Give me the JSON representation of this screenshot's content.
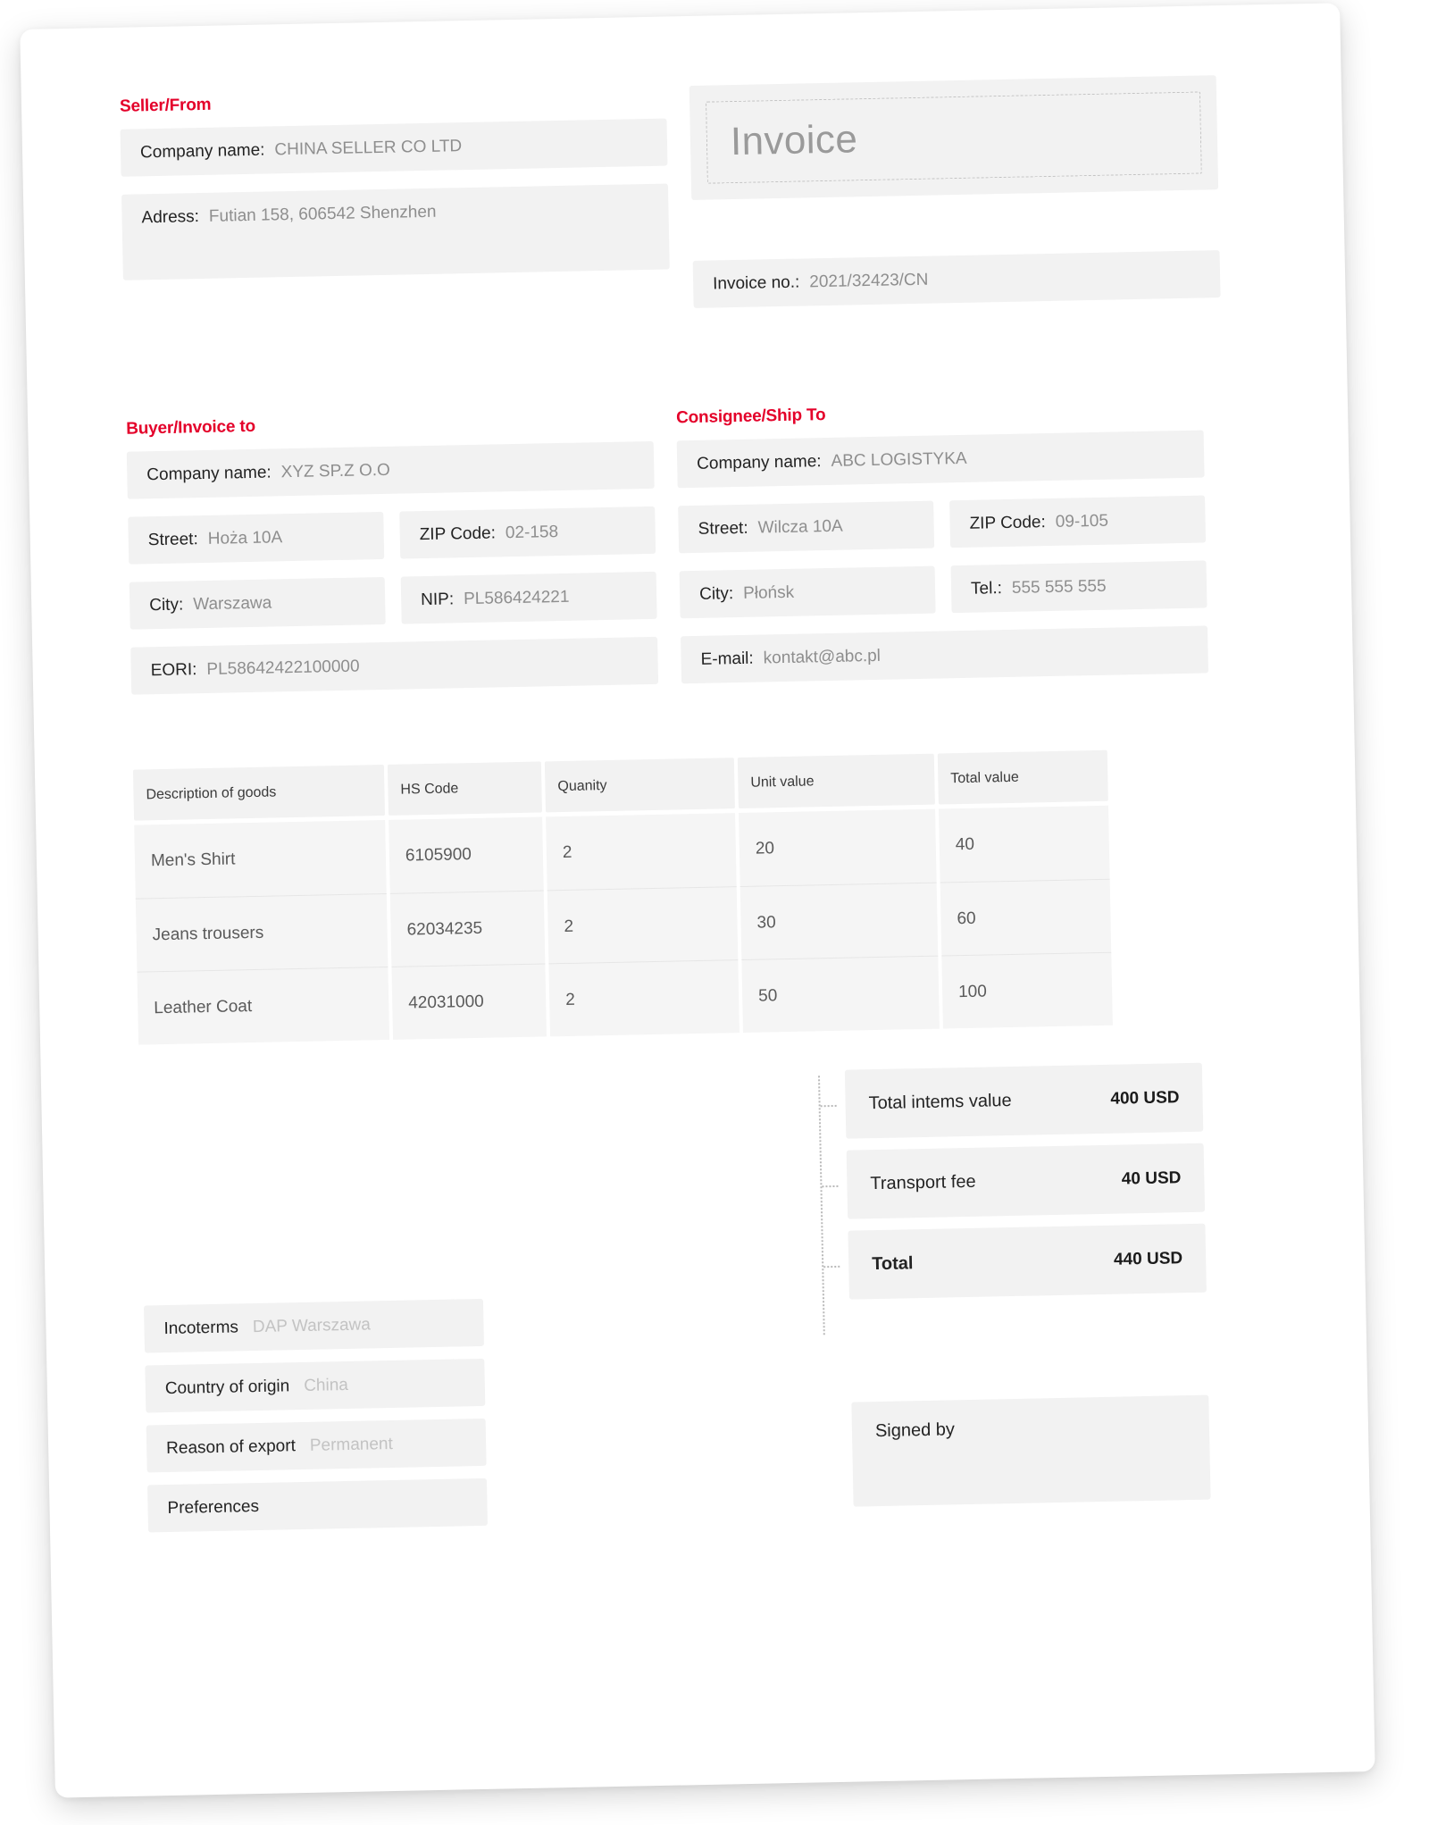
{
  "document": {
    "title": "Invoice"
  },
  "invoice_meta": {
    "number_label": "Invoice no.:",
    "number_value": "2021/32423/CN"
  },
  "seller": {
    "heading": "Seller/From",
    "company_label": "Company name:",
    "company_value": "CHINA SELLER CO LTD",
    "address_label": "Adress:",
    "address_value": "Futian 158, 606542 Shenzhen"
  },
  "buyer": {
    "heading": "Buyer/Invoice to",
    "company_label": "Company name:",
    "company_value": "XYZ SP.Z O.O",
    "street_label": "Street:",
    "street_value": "Hoża 10A",
    "zip_label": "ZIP Code:",
    "zip_value": "02-158",
    "city_label": "City:",
    "city_value": "Warszawa",
    "nip_label": "NIP:",
    "nip_value": "PL586424221",
    "eori_label": "EORI:",
    "eori_value": "PL58642422100000"
  },
  "consignee": {
    "heading": "Consignee/Ship To",
    "company_label": "Company name:",
    "company_value": "ABC LOGISTYKA",
    "street_label": "Street:",
    "street_value": "Wilcza 10A",
    "zip_label": "ZIP Code:",
    "zip_value": "09-105",
    "city_label": "City:",
    "city_value": "Płońsk",
    "tel_label": "Tel.:",
    "tel_value": "555 555 555",
    "email_label": "E-mail:",
    "email_value": "kontakt@abc.pl"
  },
  "goods_table": {
    "columns": [
      "Description of goods",
      "HS Code",
      "Quanity",
      "Unit value",
      "Total value"
    ],
    "rows": [
      {
        "description": "Men's Shirt",
        "hs_code": "6105900",
        "quantity": "2",
        "unit_value": "20",
        "total_value": "40"
      },
      {
        "description": "Jeans trousers",
        "hs_code": "62034235",
        "quantity": "2",
        "unit_value": "30",
        "total_value": "60"
      },
      {
        "description": "Leather Coat",
        "hs_code": "42031000",
        "quantity": "2",
        "unit_value": "50",
        "total_value": "100"
      }
    ]
  },
  "bottom_fields": [
    {
      "label": "Incoterms",
      "value": "DAP Warszawa"
    },
    {
      "label": "Country of origin",
      "value": "China"
    },
    {
      "label": "Reason of export",
      "value": "Permanent"
    },
    {
      "label": "Preferences",
      "value": ""
    }
  ],
  "totals": [
    {
      "label": "Total intems value",
      "amount": "400 USD",
      "emphasis": false
    },
    {
      "label": "Transport fee",
      "amount": "40 USD",
      "emphasis": false
    },
    {
      "label": "Total",
      "amount": "440 USD",
      "emphasis": true
    }
  ],
  "signature": {
    "label": "Signed by"
  },
  "colors": {
    "accent_red": "#e4012a",
    "field_bg": "#f2f2f2",
    "value_gray": "#8e8e8e",
    "placeholder_gray": "#c3c3c3"
  }
}
